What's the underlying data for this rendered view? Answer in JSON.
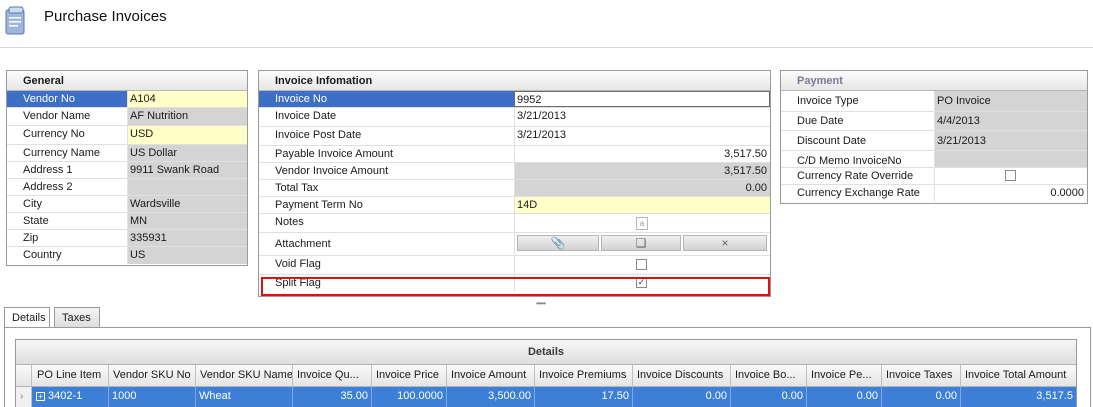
{
  "page": {
    "title": "Purchase Invoices",
    "icon": "document-stack-icon"
  },
  "general": {
    "header": "General",
    "rows": [
      {
        "label": "Vendor No",
        "value": "A104"
      },
      {
        "label": "Vendor Name",
        "value": "AF Nutrition"
      },
      {
        "label": "Currency No",
        "value": "USD"
      },
      {
        "label": "Currency Name",
        "value": "US Dollar"
      },
      {
        "label": "Address 1",
        "value": "9911 Swank Road"
      },
      {
        "label": "Address 2",
        "value": ""
      },
      {
        "label": "City",
        "value": "Wardsville"
      },
      {
        "label": "State",
        "value": "MN"
      },
      {
        "label": "Zip",
        "value": "335931"
      },
      {
        "label": "Country",
        "value": "US"
      }
    ]
  },
  "invoice": {
    "header": "Invoice Infomation",
    "rows": [
      {
        "label": "Invoice No",
        "value": "9952"
      },
      {
        "label": "Invoice Date",
        "value": "3/21/2013"
      },
      {
        "label": "Invoice Post Date",
        "value": "3/21/2013"
      },
      {
        "label": "Payable Invoice Amount",
        "value": "3,517.50"
      },
      {
        "label": "Vendor Invoice Amount",
        "value": "3,517.50"
      },
      {
        "label": "Total Tax",
        "value": "0.00"
      },
      {
        "label": "Payment Term No",
        "value": "14D"
      },
      {
        "label": "Notes",
        "value": ""
      },
      {
        "label": "Attachment",
        "value": ""
      },
      {
        "label": "Void Flag",
        "value": ""
      },
      {
        "label": "Split Flag",
        "value": ""
      }
    ],
    "notes_icon": "note-icon",
    "attachment_icons": [
      "paperclip-icon",
      "copy-icon",
      "delete-icon"
    ],
    "void_flag_checked": false,
    "split_flag_checked": true
  },
  "payment": {
    "header": "Payment",
    "rows": [
      {
        "label": "Invoice Type",
        "value": "PO Invoice"
      },
      {
        "label": "Due Date",
        "value": "4/4/2013"
      },
      {
        "label": "Discount Date",
        "value": "3/21/2013"
      },
      {
        "label": "C/D Memo InvoiceNo",
        "value": ""
      },
      {
        "label": "Currency Rate Override",
        "value": ""
      },
      {
        "label": "Currency Exchange Rate",
        "value": "0.0000"
      }
    ],
    "rate_override_checked": false
  },
  "tabs": [
    {
      "label": "Details"
    },
    {
      "label": "Taxes"
    }
  ],
  "details": {
    "caption": "Details",
    "columns": [
      "PO Line Item",
      "Vendor SKU No",
      "Vendor SKU Name",
      "Invoice Qu...",
      "Invoice Price",
      "Invoice Amount",
      "Invoice Premiums",
      "Invoice Discounts",
      "Invoice Bo...",
      "Invoice Pe...",
      "Invoice Taxes",
      "Invoice Total Amount"
    ],
    "rows": [
      [
        "3402-1",
        "1000",
        "Wheat",
        "35.00",
        "100.0000",
        "3,500.00",
        "17.50",
        "0.00",
        "0.00",
        "0.00",
        "0.00",
        "3,517.5"
      ]
    ]
  },
  "colors": {
    "selection": "#3d6fc6",
    "row_selected": "#3d7fd6",
    "required_field": "#ffffc8",
    "readonly_field": "#d4d4d4",
    "highlight_border": "#e01010"
  }
}
